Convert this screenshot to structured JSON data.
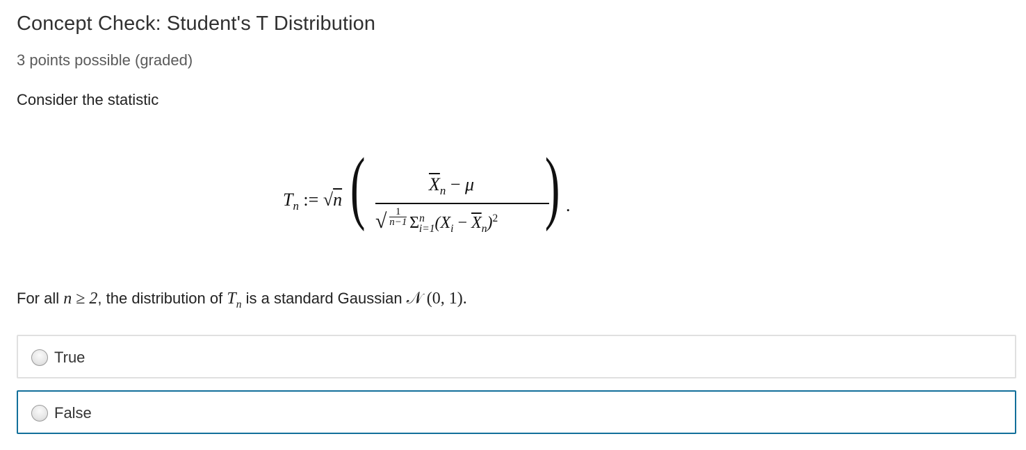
{
  "problem": {
    "title": "Concept Check: Student's T Distribution",
    "points": "3 points possible (graded)",
    "intro": "Consider the statistic"
  },
  "question": {
    "prefix": "For all",
    "condition": "n ≥ 2",
    "middle": ", the distribution of",
    "variable": "T",
    "variable_sub": "n",
    "suffix": "is a standard Gaussian",
    "distribution": "𝒩 (0, 1)."
  },
  "choices": [
    {
      "label": "True",
      "selected": false
    },
    {
      "label": "False",
      "selected": false
    }
  ]
}
